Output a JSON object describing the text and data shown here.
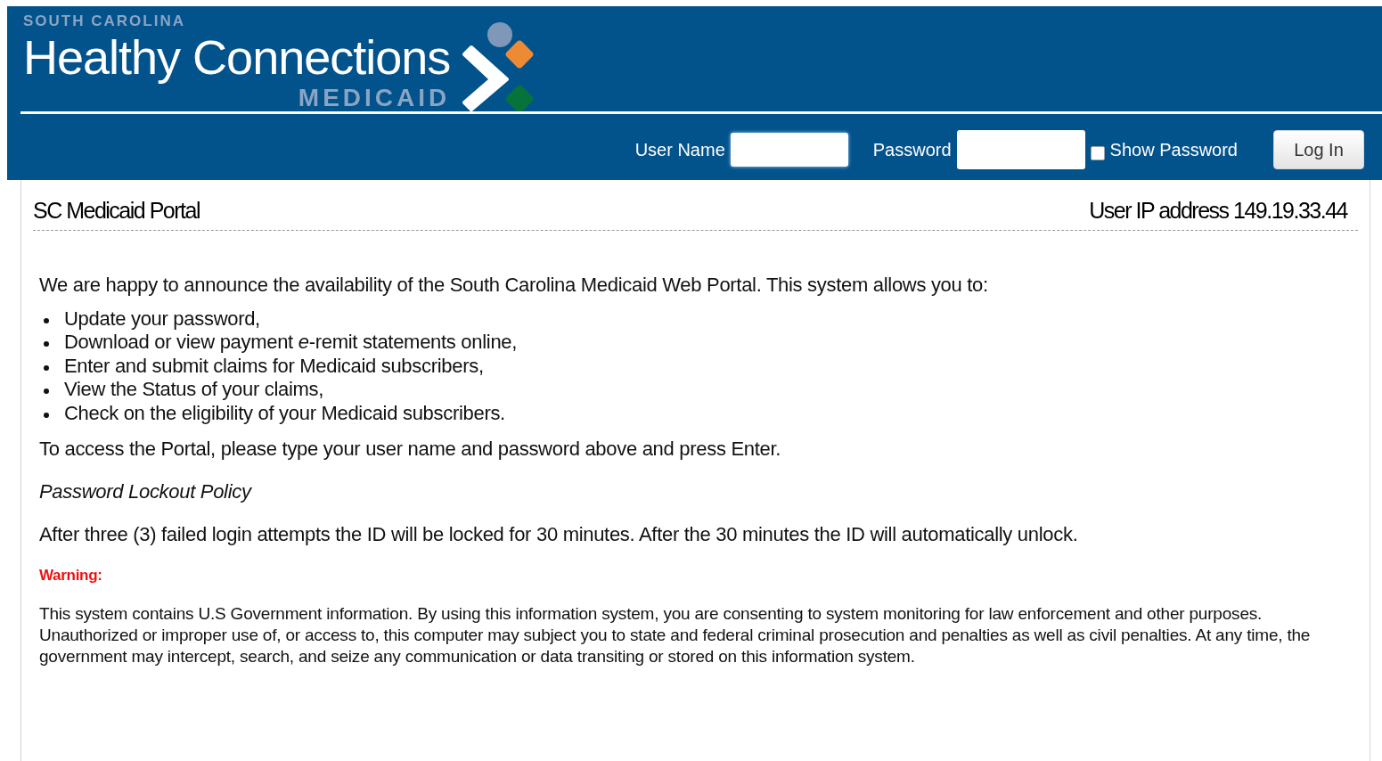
{
  "header": {
    "brand_top": "SOUTH CAROLINA",
    "brand_main": "Healthy Connections",
    "brand_sub": "MEDICAID"
  },
  "login": {
    "username_label": "User Name",
    "password_label": "Password",
    "show_password": {
      "label": "Show Password",
      "checked": false
    },
    "button": "Log In"
  },
  "portal": {
    "title": "SC Medicaid Portal",
    "ip": "User IP address 149.19.33.44"
  },
  "intro": "We are happy to announce the availability of the South Carolina Medicaid Web Portal. This system allows you to:",
  "features": [
    "Update your password,",
    "Download or view payment *e*-remit statements online,",
    "Enter and submit claims for Medicaid subscribers,",
    "View the Status of your claims,",
    "Check on the eligibility of your Medicaid subscribers."
  ],
  "access": "To access the Portal, please type your user name and password above and press Enter.",
  "policy_title": "Password Lockout Policy",
  "policy": "After three (3) failed login attempts the ID will be locked for 30 minutes. After the 30 minutes the ID will automatically unlock.",
  "warning_label": "Warning:",
  "warning": "This system contains U.S Government information. By using this information system, you are consenting to system monitoring for law enforcement and other purposes. Unauthorized or improper use of, or access to, this computer may subject you to state and federal criminal prosecution and penalties as well as civil penalties. At any time, the government may intercept, search, and seize any communication or data transiting or stored on this information system."
}
